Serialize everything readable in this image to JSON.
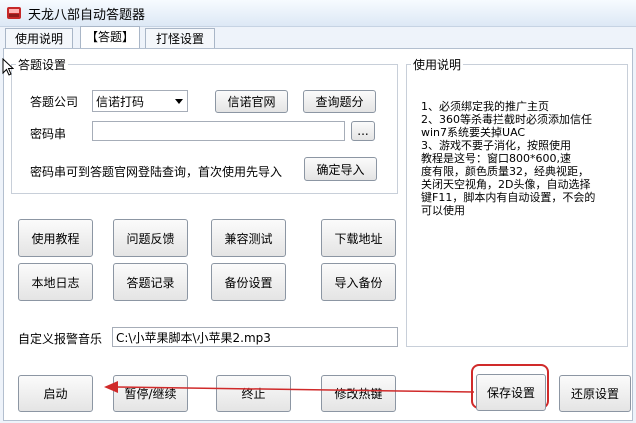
{
  "window": {
    "title": "天龙八部自动答题器",
    "accent": "#d02a2a"
  },
  "tabs": [
    {
      "label": "使用说明",
      "active": false
    },
    {
      "label": "【答题】",
      "active": true
    },
    {
      "label": "打怪设置",
      "active": false
    }
  ],
  "answer_settings": {
    "title": "答题设置",
    "company_label": "答题公司",
    "company_value": "信诺打码",
    "official_site_button": "信诺官网",
    "check_points_button": "查询题分",
    "password_label": "密码串",
    "password_value": "",
    "browse_button": "...",
    "hint": "密码串可到答题官网登陆查询，首次使用先导入",
    "confirm_import_button": "确定导入"
  },
  "instructions": {
    "title": "使用说明",
    "text": "1、必须绑定我的推广主页\n2、360等杀毒拦截时必须添加信任\nwin7系统要关掉UAC\n3、游戏不要子消化，按照使用\n教程是这号：窗口800*600,速\n度有限，颜色质量32，经典视距，\n关闭天空视角，2D头像，自动选择\n键F11，脚本内有自动设置，不会的\n可以使用"
  },
  "tool_buttons": {
    "tutorial": "使用教程",
    "feedback": "问题反馈",
    "compat_test": "兼容测试",
    "download": "下载地址",
    "local_log": "本地日志",
    "answer_log": "答题记录",
    "backup_settings": "备份设置",
    "import_backup": "导入备份"
  },
  "alarm": {
    "label": "自定义报警音乐",
    "path": "C:\\小苹果脚本\\小苹果2.mp3"
  },
  "bottom_buttons": {
    "start": "启动",
    "pause_resume": "暂停/继续",
    "stop": "终止",
    "modify_hotkey": "修改热键",
    "save_settings": "保存设置",
    "restore_settings": "还原设置"
  }
}
